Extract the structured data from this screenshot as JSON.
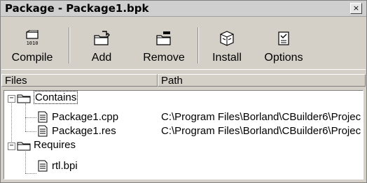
{
  "window": {
    "title": "Package - Package1.bpk",
    "close_glyph": "×"
  },
  "toolbar": {
    "buttons": [
      {
        "label": "Compile",
        "icon": "compile-icon"
      },
      {
        "label": "Add",
        "icon": "add-icon"
      },
      {
        "label": "Remove",
        "icon": "remove-icon"
      },
      {
        "label": "Install",
        "icon": "install-icon"
      },
      {
        "label": "Options",
        "icon": "options-icon"
      }
    ]
  },
  "columns": {
    "files": "Files",
    "path": "Path"
  },
  "tree": {
    "contains": {
      "label": "Contains",
      "expander": "−",
      "items": [
        {
          "name": "Package1.cpp",
          "path": "C:\\Program Files\\Borland\\CBuilder6\\Projec"
        },
        {
          "name": "Package1.res",
          "path": "C:\\Program Files\\Borland\\CBuilder6\\Projec"
        }
      ]
    },
    "requires": {
      "label": "Requires",
      "expander": "−",
      "items": [
        {
          "name": "rtl.bpi",
          "path": ""
        }
      ]
    }
  },
  "colors": {
    "window_bg": "#d4d0c8",
    "titlebar_bg": "#cfcfcf",
    "tree_bg": "#ffffff"
  }
}
